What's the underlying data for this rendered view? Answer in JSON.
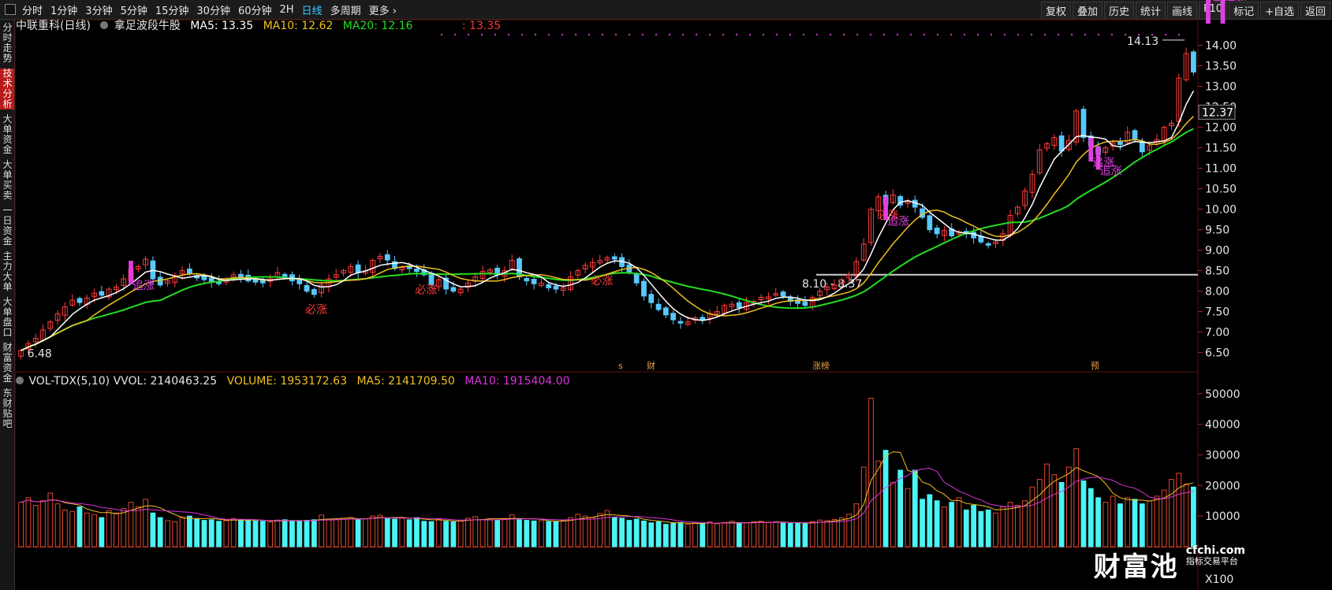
{
  "topbar": {
    "periods": [
      "分时",
      "1分钟",
      "3分钟",
      "5分钟",
      "15分钟",
      "30分钟",
      "60分钟",
      "2H",
      "日线",
      "多周期",
      "更多"
    ],
    "active_period": "日线",
    "tools": [
      "复权",
      "叠加",
      "历史",
      "统计",
      "画线",
      "F10",
      "标记",
      "+自选",
      "返回"
    ]
  },
  "sidebar": {
    "tabs": [
      "分时走势",
      "技术分析",
      "大单资金",
      "大单买卖",
      "一日资金",
      "主力大单",
      "大单盘口",
      "财富资金",
      "东财贴吧"
    ],
    "active": "技术分析"
  },
  "main_legend": {
    "title": "中联重科(日线)",
    "indicator": "拿足波段牛股",
    "ma5": "MA5: 13.35",
    "ma10": "MA10: 12.62",
    "ma20": "MA20: 12.16",
    "extra": ": 13.35",
    "ma5_color": "#ffffff",
    "ma10_color": "#f0c020",
    "ma20_color": "#22dd22",
    "extra_color": "#ff3333"
  },
  "volume_legend": {
    "title": "VOL-TDX(5,10) VVOL: 2140463.25",
    "volume": "VOLUME: 1953172.63",
    "ma5": "MA5: 2141709.50",
    "ma10": "MA10: 1915404.00"
  },
  "annotations": {
    "high_label": "14.13",
    "low_label": "6.48",
    "range_label": "8.10 - 8.37",
    "current_price": "12.37",
    "bi_zhang": "必涨",
    "zhui_zhang": "追涨",
    "event_markers": [
      "s",
      "财",
      "涨榜",
      "预"
    ]
  },
  "price_axis": [
    "14.00",
    "13.50",
    "13.00",
    "12.50",
    "12.00",
    "11.50",
    "11.00",
    "10.50",
    "10.00",
    "9.50",
    "9.00",
    "8.50",
    "8.00",
    "7.50",
    "7.00",
    "6.50"
  ],
  "volume_axis": [
    "50000",
    "40000",
    "30000",
    "20000",
    "10000"
  ],
  "volume_unit": "X100",
  "watermark": {
    "brand": "财富池",
    "domain": "cfchi.com",
    "slogan": "指标交易平台"
  },
  "colors": {
    "up": "#ff3b3b",
    "down": "#58c8ff",
    "bg": "#000000",
    "ma5": "#ffffff",
    "ma10": "#f0c020",
    "ma20": "#22dd22",
    "vol_up": "#e0492f",
    "vol_down": "#4af4f4"
  },
  "chart_data": {
    "type": "candlestick",
    "price_ylim": [
      6.3,
      14.3
    ],
    "volume_ylim": [
      0,
      52000
    ],
    "close": [
      6.55,
      6.72,
      6.85,
      7.05,
      7.25,
      7.45,
      7.62,
      7.78,
      7.72,
      7.83,
      7.95,
      7.9,
      8.05,
      8.1,
      8.3,
      8.55,
      8.6,
      8.78,
      8.3,
      8.15,
      8.25,
      8.38,
      8.5,
      8.42,
      8.32,
      8.28,
      8.22,
      8.18,
      8.3,
      8.4,
      8.35,
      8.25,
      8.22,
      8.2,
      8.3,
      8.45,
      8.36,
      8.25,
      8.18,
      8.0,
      7.92,
      8.15,
      8.3,
      8.4,
      8.5,
      8.6,
      8.45,
      8.5,
      8.75,
      8.85,
      8.76,
      8.55,
      8.58,
      8.55,
      8.48,
      8.4,
      8.15,
      8.28,
      8.05,
      8.0,
      8.05,
      8.2,
      8.35,
      8.48,
      8.52,
      8.4,
      8.5,
      8.75,
      8.35,
      8.25,
      8.18,
      8.2,
      8.08,
      8.05,
      8.08,
      8.35,
      8.5,
      8.63,
      8.7,
      8.75,
      8.82,
      8.78,
      8.6,
      8.45,
      8.2,
      7.88,
      7.72,
      7.55,
      7.42,
      7.3,
      7.22,
      7.25,
      7.35,
      7.3,
      7.45,
      7.5,
      7.65,
      7.68,
      7.6,
      7.72,
      7.75,
      7.85,
      7.86,
      7.94,
      7.88,
      7.75,
      7.7,
      7.65,
      7.85,
      8.0,
      8.1,
      8.15,
      8.28,
      8.4,
      8.72,
      9.15,
      10.0,
      10.3,
      10.12,
      10.35,
      10.1,
      10.18,
      10.05,
      9.8,
      9.5,
      9.4,
      9.48,
      9.35,
      9.45,
      9.4,
      9.3,
      9.2,
      9.12,
      9.2,
      9.4,
      9.85,
      10.05,
      10.45,
      10.85,
      11.45,
      11.6,
      11.75,
      11.42,
      11.68,
      12.4,
      11.75,
      11.55,
      11.35,
      11.5,
      11.62,
      11.58,
      11.88,
      11.7,
      11.4,
      11.55,
      11.7,
      12.0,
      12.1,
      13.2,
      13.8,
      13.35
    ],
    "volume": [
      14500,
      16000,
      13500,
      15000,
      17500,
      14000,
      12000,
      11500,
      13000,
      11000,
      10500,
      9500,
      11800,
      11000,
      12500,
      14500,
      13000,
      15500,
      11000,
      9500,
      8500,
      8200,
      9800,
      10000,
      9200,
      8600,
      8800,
      8300,
      8500,
      9200,
      8700,
      8600,
      8400,
      8300,
      8100,
      8700,
      8800,
      8400,
      8300,
      8600,
      8800,
      10300,
      9000,
      8900,
      9300,
      9500,
      8800,
      9100,
      10000,
      10300,
      9200,
      9000,
      9400,
      8800,
      9500,
      8300,
      8200,
      9000,
      8300,
      8100,
      8400,
      9300,
      9800,
      8800,
      9100,
      8700,
      9200,
      10400,
      8800,
      8600,
      8400,
      8500,
      8200,
      8100,
      8600,
      9500,
      10600,
      10000,
      9500,
      10800,
      11800,
      9600,
      9300,
      8600,
      9000,
      8400,
      7800,
      8100,
      7300,
      7600,
      7900,
      7300,
      7800,
      7600,
      8100,
      7500,
      7900,
      8300,
      7600,
      7800,
      8100,
      8300,
      7900,
      8100,
      7700,
      7600,
      7800,
      7500,
      8200,
      8700,
      8500,
      8900,
      9400,
      10600,
      14000,
      26000,
      48500,
      28000,
      31500,
      21000,
      25000,
      19000,
      25000,
      15500,
      17000,
      15000,
      13000,
      14500,
      16000,
      12000,
      13500,
      11500,
      12000,
      11000,
      13000,
      14500,
      13500,
      15000,
      19500,
      22000,
      27000,
      23500,
      21000,
      26000,
      32000,
      21500,
      19000,
      16000,
      14500,
      16500,
      14000,
      16000,
      15500,
      14000,
      15000,
      16500,
      18500,
      22000,
      24000,
      20500,
      19500
    ]
  }
}
